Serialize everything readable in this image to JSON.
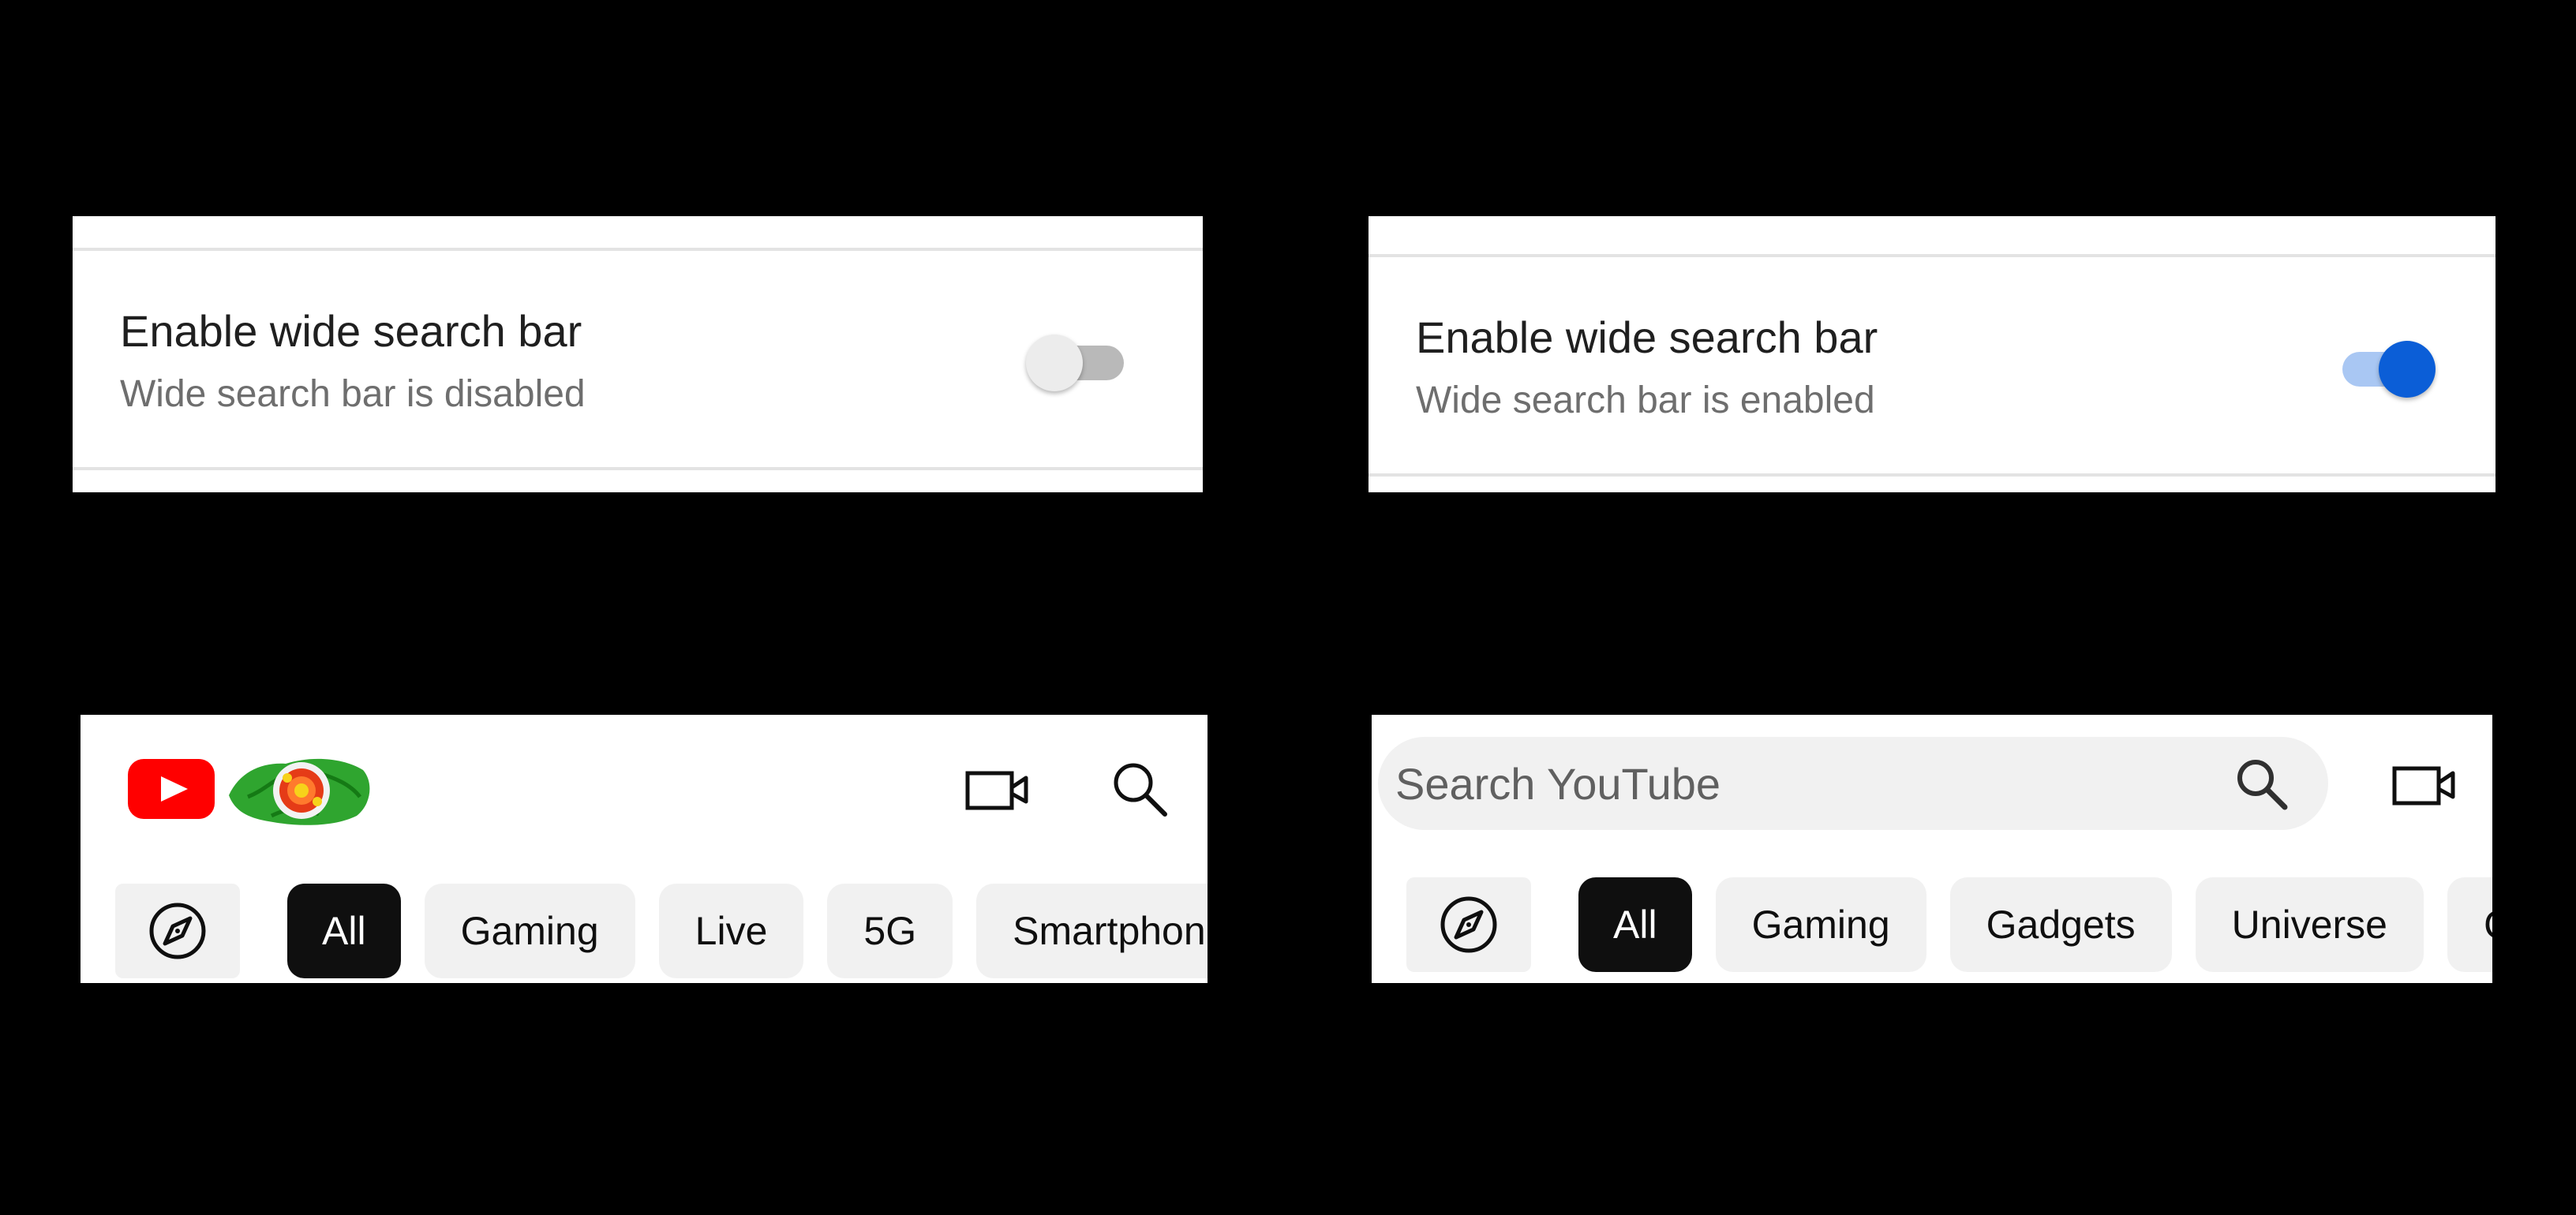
{
  "colors": {
    "toggle_on": "#0b5ed7",
    "toggle_on_track": "#a9c7f3",
    "toggle_off_thumb": "#ececec",
    "toggle_off_track": "#b9b9b9",
    "youtube_red": "#ff0000",
    "chip_selected": "#0f0f0f",
    "chip_background": "#f1f1f1"
  },
  "settings_disabled": {
    "title": "Enable wide search bar",
    "summary": "Wide search bar is disabled",
    "toggle_on": false
  },
  "settings_enabled": {
    "title": "Enable wide search bar",
    "summary": "Wide search bar is enabled",
    "toggle_on": true
  },
  "header_narrow": {
    "icons": [
      "youtube-logo-icon",
      "doodle-icon",
      "video-camera-icon",
      "search-icon",
      "explore-compass-icon"
    ],
    "chips": [
      "All",
      "Gaming",
      "Live",
      "5G",
      "Smartphon"
    ],
    "selected_chip": "All"
  },
  "header_wide": {
    "search_placeholder": "Search YouTube",
    "icons": [
      "search-icon",
      "video-camera-icon",
      "explore-compass-icon"
    ],
    "chips": [
      "All",
      "Gaming",
      "Gadgets",
      "Universe",
      "C"
    ],
    "selected_chip": "All"
  }
}
